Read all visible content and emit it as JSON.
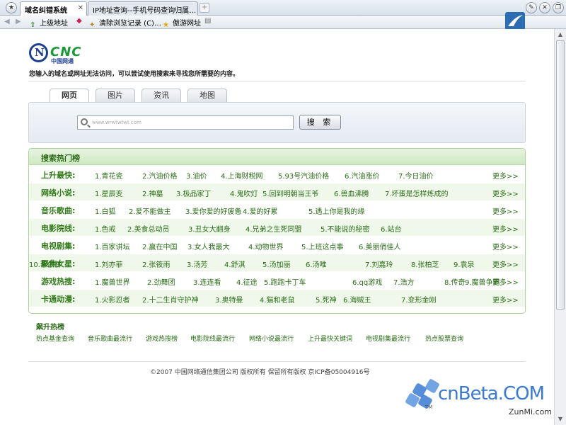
{
  "browser": {
    "tabs": [
      {
        "label": "域名纠错系统",
        "active": true
      },
      {
        "label": "IP地址查询--手机号码查询归属…",
        "active": false
      }
    ],
    "toolbar": {
      "parent": "上级地址",
      "clear_history": "清除浏览记录 (C)…",
      "favorites": "傲游网址",
      "close": "关闭"
    }
  },
  "page": {
    "logo_text": "CNC",
    "logo_sub": "中国网通",
    "notice": "您输入的域名或网址无法访问，可以尝试使用搜索来寻找您所需要的内容。",
    "search_tabs": [
      "网页",
      "图片",
      "资讯",
      "地图"
    ],
    "search": {
      "placeholder": "www.wrwtwtwt.com",
      "button": "搜 索"
    },
    "hot": {
      "title": "搜索热门榜",
      "more": "更多>>",
      "rows": [
        {
          "category": "上升最快:",
          "items": [
            "1.青花瓷",
            "2.汽油价格",
            "3.油价",
            "4.上海财税网",
            "5.93号汽油价格",
            "6.汽油涨价",
            "7.今日油价"
          ]
        },
        {
          "category": "网络小说:",
          "items": [
            "1.星辰变",
            "2.神墓",
            "3.极品家丁",
            "4.鬼吹灯",
            "5.回到明朝当王爷",
            "6.兽血沸腾",
            "7.坏蛋是怎样炼成的"
          ]
        },
        {
          "category": "音乐歌曲:",
          "items": [
            "1.白狐",
            "2.爱不能做主",
            "3.爱你爱的好疲惫",
            "4.爱的好累",
            "5.遇上你是我的缘"
          ]
        },
        {
          "category": "电影院线:",
          "items": [
            "1.色戒",
            "2.美食总动员",
            "3.丑女大翻身",
            "4.兄弟之生死同盟",
            "5.不能说的秘密",
            "6.站台"
          ]
        },
        {
          "category": "电视剧集:",
          "items": [
            "1.百家讲坛",
            "2.赢在中国",
            "3.女人我最大",
            "4.动物世界",
            "5.上班这点事",
            "6.美丽俏佳人"
          ]
        },
        {
          "category": "聚焦女星:",
          "items": [
            "1.刘亦菲",
            "2.张筱雨",
            "3.汤芳",
            "4.舒淇",
            "5.汤加丽",
            "6.汤唯",
            "7.刘嘉玲",
            "8.张柏芝",
            "9.袁泉",
            "10.蔡依林"
          ]
        },
        {
          "category": "游戏热搜:",
          "items": [
            "1.魔兽世界",
            "2.劲舞团",
            "3.连连看",
            "4.征途",
            "5.跑跑卡丁车",
            "6.qq游戏",
            "7.浩方",
            "8.传奇",
            "9.魔兽争霸"
          ]
        },
        {
          "category": "卡通动漫:",
          "items": [
            "1.火影忍者",
            "2.十二生肖守护神",
            "3.奥特曼",
            "4.猫和老鼠",
            "5.死神",
            "6.海贼王",
            "7.变形金刚"
          ]
        }
      ]
    },
    "rising": {
      "title": "飙升热榜",
      "links": [
        "热点基金查询",
        "音乐歌曲最流行",
        "游戏热搜榜",
        "电影院线最流行",
        "网络小说最流行",
        "上升最快关键词",
        "电视剧集最流行",
        "热点股票查询"
      ]
    },
    "copyright": "©2007 中国网络通信集团公司 版权所有 保留所有版权     京ICP备05004916号"
  },
  "watermark": {
    "brand": "cnBeta.COM",
    "tm": "TM",
    "site": "ZunMi.com"
  }
}
